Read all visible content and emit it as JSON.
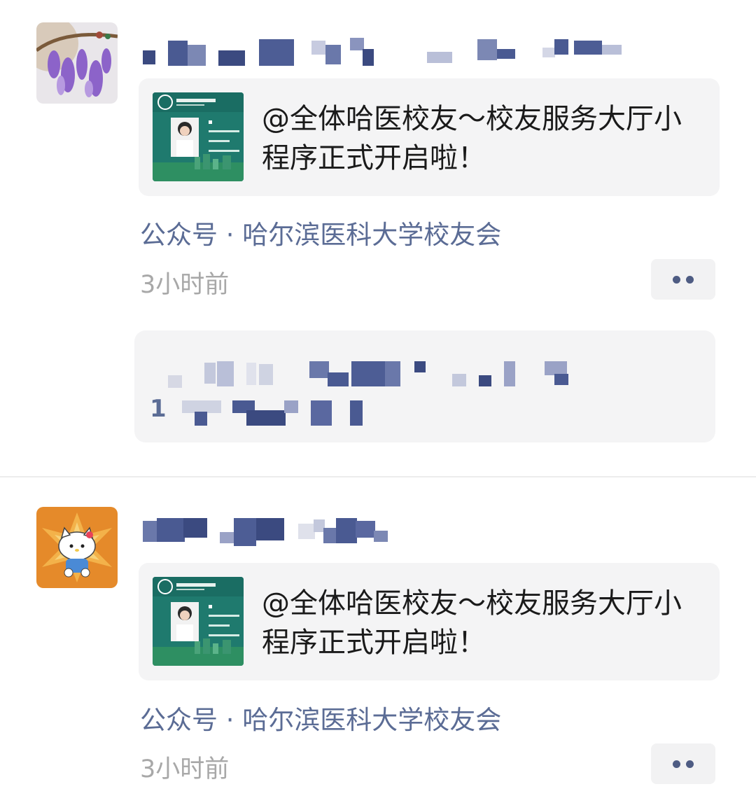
{
  "posts": [
    {
      "avatar_icon": "wisteria-flower-avatar",
      "article_title": "@全体哈医校友～校友服务大厅小程序正式开启啦！",
      "source_line": "公众号 · 哈尔滨医科大学校友会",
      "time": "3小时前",
      "more_icon": "more-dots-icon"
    },
    {
      "avatar_icon": "hello-kitty-avatar",
      "article_title": "@全体哈医校友～校友服务大厅小程序正式开启啦！",
      "source_line": "公众号 · 哈尔滨医科大学校友会",
      "time": "3小时前",
      "more_icon": "more-dots-icon"
    }
  ],
  "comment": {
    "count_prefix": "1"
  },
  "colors": {
    "link_blue": "#5b6c95",
    "muted_gray": "#a8a8a8",
    "card_bg": "#f4f4f5"
  }
}
